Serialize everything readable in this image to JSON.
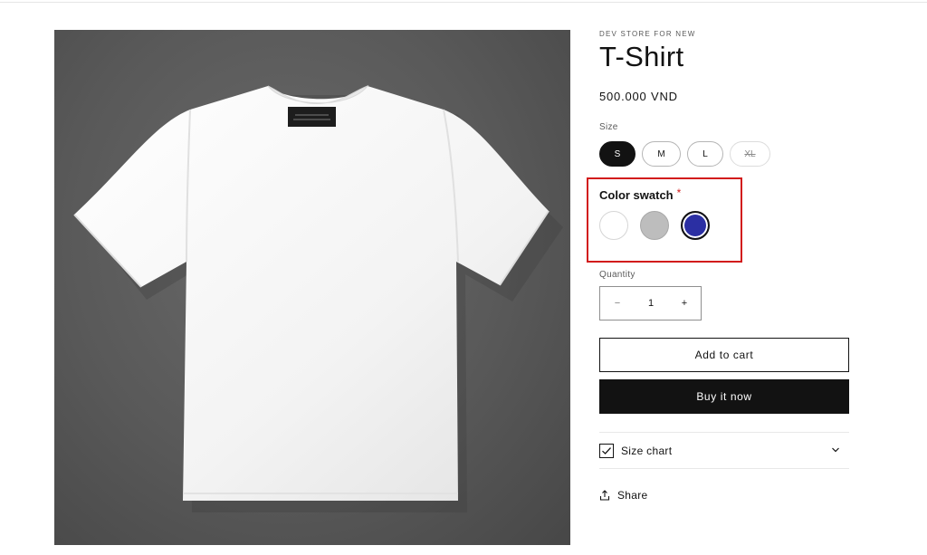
{
  "product": {
    "vendor": "DEV STORE FOR NEW",
    "title": "T-Shirt",
    "price": "500.000 VND",
    "image_alt": "White t-shirt on grey background"
  },
  "size_picker": {
    "label": "Size",
    "options": [
      {
        "label": "S",
        "state": "selected"
      },
      {
        "label": "M",
        "state": "available"
      },
      {
        "label": "L",
        "state": "available"
      },
      {
        "label": "XL",
        "state": "sold-out"
      }
    ]
  },
  "color_picker": {
    "label": "Color swatch",
    "required_mark": "*",
    "swatches": [
      {
        "name": "white-swatch",
        "color": "#ffffff",
        "selected": false
      },
      {
        "name": "grey-swatch",
        "color": "#bdbdbd",
        "selected": false
      },
      {
        "name": "blue-swatch",
        "color": "#2b2fa3",
        "selected": true
      }
    ],
    "highlight_color": "#d21c1c"
  },
  "quantity": {
    "label": "Quantity",
    "value": "1",
    "minus": "−",
    "plus": "+"
  },
  "buttons": {
    "add_to_cart": "Add to cart",
    "buy_now": "Buy it now"
  },
  "accordion": {
    "size_chart_label": "Size chart",
    "icon": "checkbox-icon"
  },
  "share": {
    "label": "Share",
    "icon": "share-icon"
  }
}
